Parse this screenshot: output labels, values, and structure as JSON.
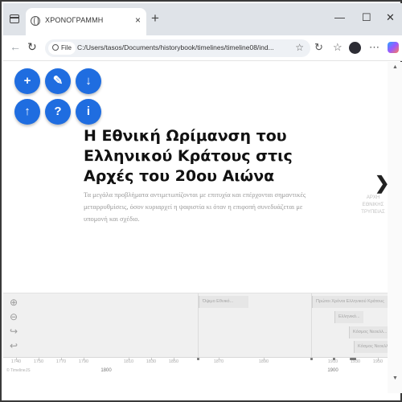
{
  "browser": {
    "tab_title": "ΧΡΟΝΟΓΡΑΜΜΗ",
    "tab_close": "×",
    "new_tab": "+",
    "file_chip": "File",
    "url": "C:/Users/tasos/Documents/historybook/timelines/timeline08/ind...",
    "window_controls": [
      "—",
      "☐",
      "✕"
    ],
    "nav": {
      "back": "←",
      "forward": "→",
      "refresh": "↻"
    },
    "icons": [
      "star-icon",
      "refresh-page-icon",
      "favorites-icon",
      "copilot-icon"
    ]
  },
  "fab_buttons": [
    {
      "name": "add-button",
      "glyph": "+"
    },
    {
      "name": "edit-button",
      "glyph": "✎"
    },
    {
      "name": "download-button",
      "glyph": "↓"
    },
    {
      "name": "upload-button",
      "glyph": "↑"
    },
    {
      "name": "help-button",
      "glyph": "?"
    },
    {
      "name": "info-button",
      "glyph": "i"
    }
  ],
  "slide": {
    "headline": "Η Εθνική Ωρίμανση του Ελληνικού Κράτους στις Αρχές του 20ου Αιώνα",
    "description": "Τα μεγάλα προβλήματα αντιμετωπίζονται με επιτυχία και επέρχονται σημαντικές μεταρρυθμίσεις, όσον κυριαρχεί η ψαφιστία κι όταν η επιφοπή συνεδυάζεται με υπομονή και σχέδιο.",
    "next_arrow": "❯",
    "next_label": "ΑΡΧΗ ΕΘΝΙΚΗΣ ΤΡΥΠΕΙΑΣ"
  },
  "timenav": {
    "controls": [
      "⊕",
      "⊖",
      "↪",
      "↩"
    ],
    "markers": [
      "Όψιμο Εθνικό...",
      "Πρώτοι Χρόνοι Ελληνικού Κράτους",
      "Ελληνικό...",
      "Κόσμος Νεοελλ...",
      "Κόσμος Νεοελλ..."
    ]
  },
  "axis": {
    "minor_ticks": [
      "1740",
      "1750",
      "1770",
      "1790",
      "1810",
      "1830",
      "1850",
      "1870",
      "1890",
      "1910",
      "1930",
      "1950"
    ],
    "major_labels": [
      "1800",
      "1900"
    ],
    "footer": "© TimelineJS"
  },
  "colors": {
    "accent": "#1f6de0",
    "timenav_bg": "#f0f0f0"
  }
}
